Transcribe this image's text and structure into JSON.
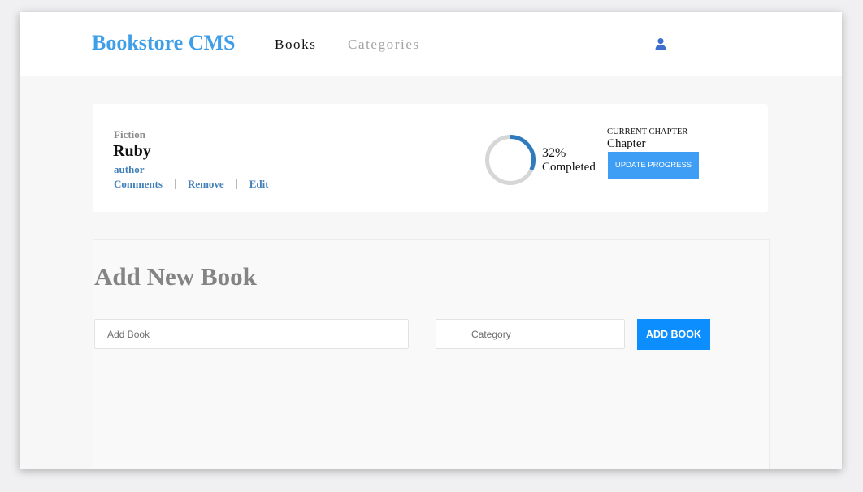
{
  "header": {
    "brand": "Bookstore CMS",
    "nav": [
      {
        "label": "Books",
        "active": true
      },
      {
        "label": "Categories",
        "active": false
      }
    ],
    "user_icon": "user-icon",
    "brand_color": "#3e9ee8"
  },
  "book": {
    "genre": "Fiction",
    "title": "Ruby",
    "author": "author",
    "actions": [
      "Comments",
      "Remove",
      "Edit"
    ],
    "progress_percent": 32,
    "percent_text": "32%",
    "completed_label": "Completed",
    "current_chapter_heading": "CURRENT CHAPTER",
    "current_chapter": "Chapter",
    "update_button": "UPDATE PROGRESS",
    "progress_color": "#307bbe"
  },
  "add_form": {
    "heading": "Add New Book",
    "book_placeholder": "Add Book",
    "category_selected": "Category",
    "submit_label": "ADD BOOK",
    "accent_color": "#0c8eff"
  }
}
